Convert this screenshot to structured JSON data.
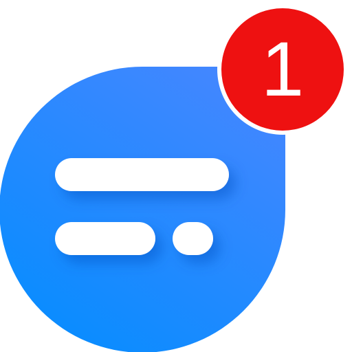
{
  "app_icon": {
    "icon": "chat-bubble-icon",
    "colors": {
      "bubble_gradient_top": "#4a86ff",
      "bubble_gradient_bottom": "#0b8cff",
      "bar_fill": "#ffffff",
      "bar_shadow": "#0a5fd6"
    }
  },
  "notification_badge": {
    "count": "1",
    "colors": {
      "fill": "#ee1111",
      "border": "#ffffff",
      "text": "#ffffff"
    }
  }
}
